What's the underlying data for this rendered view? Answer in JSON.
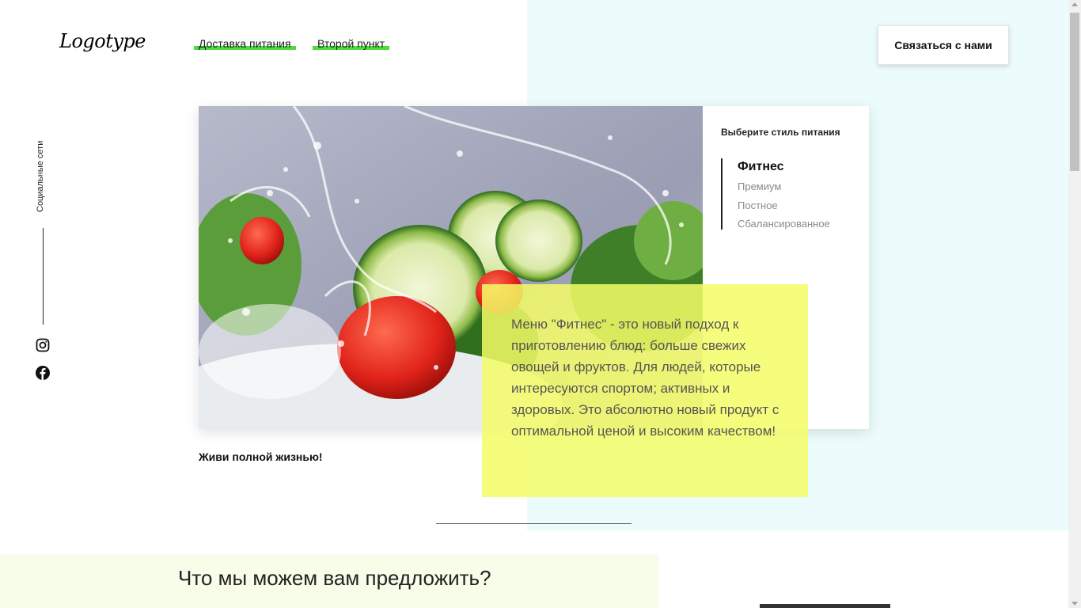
{
  "header": {
    "logo": "Logotype",
    "nav": [
      {
        "label": "Доставка питания"
      },
      {
        "label": "Второй пункт"
      }
    ],
    "contact_label": "Связаться с нами",
    "accent_color": "#4ddc3c"
  },
  "social": {
    "label": "Социальные сети",
    "icons": [
      "instagram-icon",
      "facebook-icon"
    ]
  },
  "hero": {
    "menu_title": "Выберите стиль питания",
    "menu_items": [
      {
        "label": "Фитнес",
        "active": true
      },
      {
        "label": "Премиум",
        "active": false
      },
      {
        "label": "Постное",
        "active": false
      },
      {
        "label": "Сбалансированное",
        "active": false
      }
    ],
    "description": "Меню \"Фитнес\" - это новый подход к приготовлению блюд: больше свежих овощей и фруктов. Для людей, которые интересуются спортом; активных и здоровых. Это абсолютно новый продукт с оптимальной ценой и высоким качеством!",
    "slogan": "Живи полной жизнью!"
  },
  "offer": {
    "title": "Что мы можем вам предложить?"
  },
  "colors": {
    "highlight": "#f5fd66",
    "right_bg": "#ecfbfc",
    "bottom_bg": "#f8fdea"
  }
}
